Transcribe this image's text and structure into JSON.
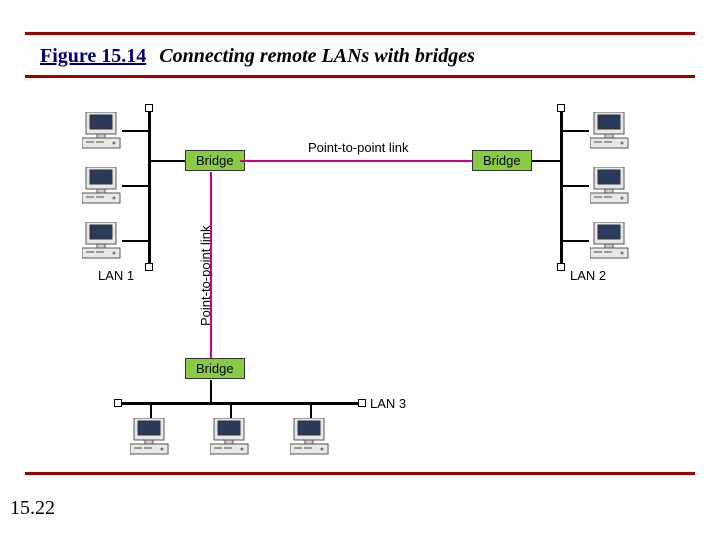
{
  "title": {
    "figure": "Figure 15.14",
    "caption": "Connecting remote LANs with bridges"
  },
  "page_number": "15.22",
  "labels": {
    "lan1": "LAN 1",
    "lan2": "LAN 2",
    "lan3": "LAN 3",
    "bridge": "Bridge",
    "ptp_h": "Point-to-point link",
    "ptp_v": "Point-to-point link"
  }
}
